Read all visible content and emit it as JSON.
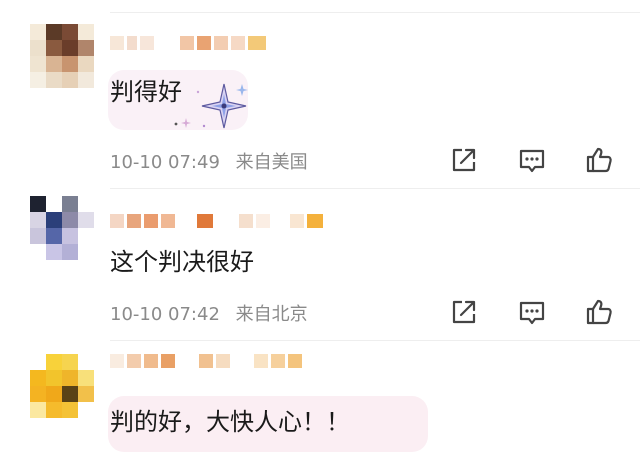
{
  "comments": [
    {
      "text": "判得好",
      "time": "10-10 07:49",
      "location": "来自美国",
      "sticker": "sparkle-sticker",
      "avatar_colors": [
        "#f4ead9",
        "#5b3a27",
        "#7a4a35",
        "#f4ead9",
        "#ece0cc",
        "#8a5a3f",
        "#6a3d2a",
        "#b0856b",
        "#efe4d1",
        "#d9b493",
        "#c8946f",
        "#ead8c0",
        "#f5efe3",
        "#eadbc6",
        "#e6d0b6",
        "#f2e9dc"
      ]
    },
    {
      "text": "这个判决很好",
      "time": "10-10 07:42",
      "location": "来自北京",
      "avatar_colors": [
        "#1e2230",
        "#ffffff",
        "#7a7f92",
        "#ffffff",
        "#d8d4e4",
        "#2b3f7a",
        "#8d8aa8",
        "#e0ddea",
        "#c9c5dc",
        "#5566a8",
        "#c7c2e0",
        "#ffffff",
        "#ffffff",
        "#c9c5e6",
        "#b3b0d6",
        "#ffffff"
      ]
    },
    {
      "text": "判的好，大快人心！！",
      "avatar_colors": [
        "#ffffff",
        "#f8d23a",
        "#f6d44f",
        "#ffffff",
        "#f4b81f",
        "#f2c42c",
        "#efb52a",
        "#f8e07a",
        "#f4b322",
        "#f0a81a",
        "#5a4216",
        "#f2c04a",
        "#fbe8a0",
        "#f5bb2c",
        "#f4c236",
        "#ffffff"
      ]
    }
  ],
  "actions": {
    "share_icon": "share-icon",
    "comment_icon": "comment-icon",
    "like_icon": "like-icon"
  },
  "colors": {
    "meta_text": "#8a8a8a",
    "icon": "#444444",
    "bubble_pink": "#fbeef3",
    "divider": "#eeeeee"
  }
}
